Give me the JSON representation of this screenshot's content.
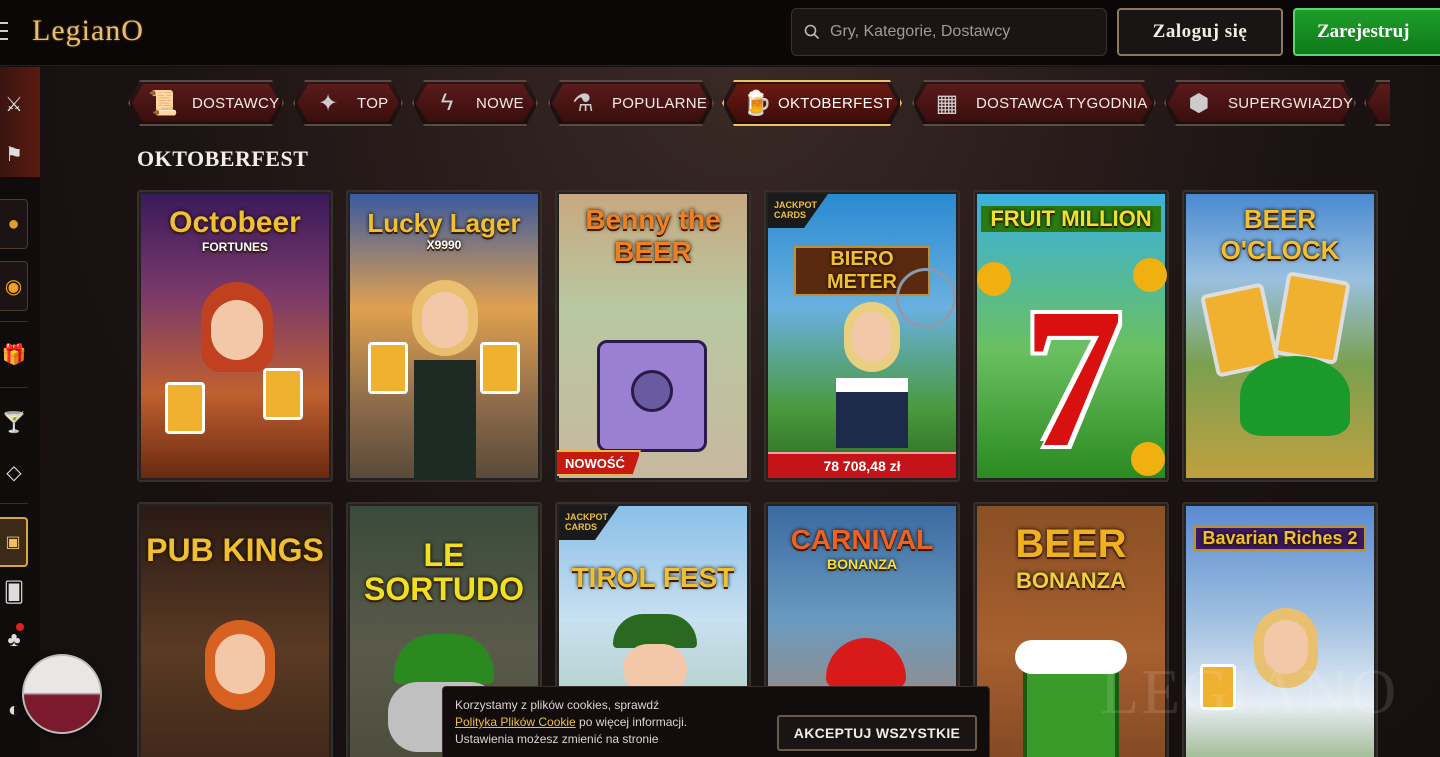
{
  "header": {
    "logo": "LegianO",
    "search_placeholder": "Gry, Kategorie, Dostawcy",
    "login_label": "Zaloguj się",
    "register_label": "Zarejestruj"
  },
  "categories": [
    {
      "label": "DOSTAWCY",
      "icon": "scroll-icon",
      "active": false
    },
    {
      "label": "TOP",
      "icon": "star-icon",
      "active": false
    },
    {
      "label": "NOWE",
      "icon": "lightning-icon",
      "active": false
    },
    {
      "label": "POPULARNE",
      "icon": "potion-icon",
      "active": false
    },
    {
      "label": "OKTOBERFEST",
      "icon": "beer-mug-icon",
      "active": true
    },
    {
      "label": "DOSTAWCA TYGODNIA",
      "icon": "calendar-icon",
      "active": false
    },
    {
      "label": "SUPERGWIAZDY",
      "icon": "gem-icon",
      "active": false
    }
  ],
  "section_title": "OKTOBERFEST",
  "games_row1": [
    {
      "title": "Octobeer",
      "subtitle": "FORTUNES",
      "badge": "",
      "jackpot": ""
    },
    {
      "title": "Lucky Lager",
      "subtitle": "X9990",
      "badge": "",
      "jackpot": ""
    },
    {
      "title": "Benny the BEER",
      "subtitle": "",
      "badge": "NOWOŚĆ",
      "jackpot": ""
    },
    {
      "title": "BIERO METER",
      "subtitle": "",
      "badge": "",
      "jackpot": "78 708,48 zł",
      "jackpot_tag": "JACKPOT CARDS"
    },
    {
      "title": "FRUIT MILLION",
      "subtitle": "",
      "badge": "",
      "jackpot": ""
    },
    {
      "title": "BEER O'CLOCK",
      "subtitle": "",
      "badge": "",
      "jackpot": ""
    }
  ],
  "games_row2": [
    {
      "title": "PUB KINGS",
      "subtitle": ""
    },
    {
      "title": "LE SORTUDO",
      "subtitle": ""
    },
    {
      "title": "TIROL FEST",
      "subtitle": "",
      "jackpot_tag": "JACKPOT CARDS"
    },
    {
      "title": "CARNIVAL",
      "subtitle": "BONANZA"
    },
    {
      "title": "BEER",
      "subtitle": "BONANZA"
    },
    {
      "title": "Bavarian Riches 2",
      "subtitle": ""
    }
  ],
  "cookie": {
    "line1": "Korzystamy z plików cookies, sprawdź",
    "link": "Polityka Plików Cookie",
    "line2": " po więcej informacji.",
    "line3": "Ustawienia możesz zmienić na stronie",
    "accept_label": "AKCEPTUJ WSZYSTKIE"
  },
  "watermark": "LEGIANO",
  "colors": {
    "gold": "#e8c06a",
    "register_green": "#1e9e2a",
    "jackpot_red": "#c4141a",
    "active_border": "#f0c060"
  }
}
